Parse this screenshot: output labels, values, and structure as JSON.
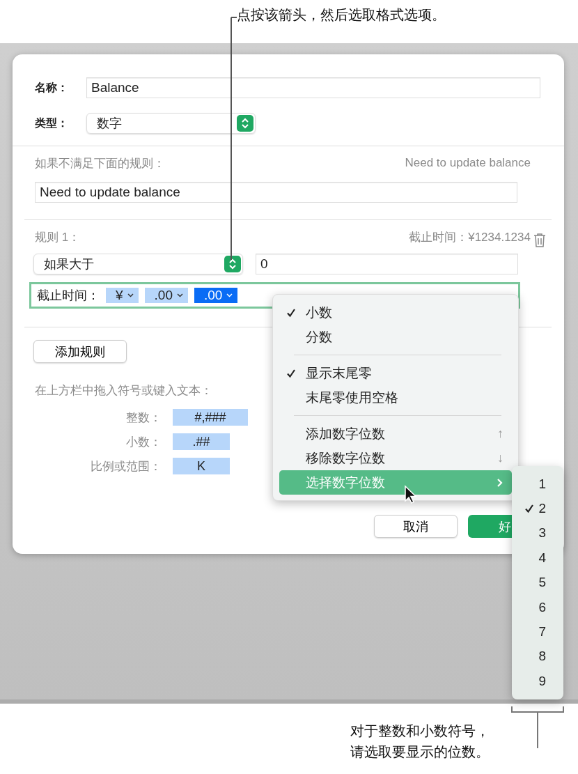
{
  "callout_top": {
    "text": "点按该箭头，然后选取格式选项。"
  },
  "dialog": {
    "name_label": "名称：",
    "name_value": "Balance",
    "type_label": "类型：",
    "type_value": "数字",
    "fallback_label": "如果不满足下面的规则：",
    "fallback_preview": "Need to update balance",
    "fallback_value": "Need to update balance",
    "rule": {
      "title": "规则 1：",
      "preview": "截止时间：¥1234.1234",
      "condition": "如果大于",
      "value": "0",
      "format_label": "截止时间：",
      "tokens": [
        {
          "text": "¥",
          "selected": false
        },
        {
          "text": ".00",
          "selected": false
        },
        {
          "text": ".00",
          "selected": true
        }
      ]
    },
    "add_rule": "添加规则",
    "hint": "在上方栏中拖入符号或键入文本：",
    "symbols": [
      {
        "label": "整数：",
        "token": "#,###"
      },
      {
        "label": "小数：",
        "token": ".##"
      },
      {
        "label": "比例或范围：",
        "token": "K"
      }
    ],
    "buttons": [
      {
        "label": "取消",
        "kind": "secondary"
      },
      {
        "label": "好",
        "kind": "primary"
      }
    ]
  },
  "menu": {
    "items": [
      {
        "kind": "item",
        "label": "小数",
        "checked": true,
        "highlighted": false
      },
      {
        "kind": "item",
        "label": "分数",
        "checked": false,
        "highlighted": false
      },
      {
        "kind": "separator"
      },
      {
        "kind": "item",
        "label": "显示末尾零",
        "checked": true,
        "highlighted": false
      },
      {
        "kind": "item",
        "label": "末尾零使用空格",
        "checked": false,
        "highlighted": false
      },
      {
        "kind": "separator"
      },
      {
        "kind": "item",
        "label": "添加数字位数",
        "shortcut": "↑",
        "checked": false,
        "highlighted": false
      },
      {
        "kind": "item",
        "label": "移除数字位数",
        "shortcut": "↓",
        "checked": false,
        "highlighted": false
      },
      {
        "kind": "submenu",
        "label": "选择数字位数",
        "checked": false,
        "highlighted": true
      }
    ]
  },
  "submenu": {
    "items": [
      {
        "label": "1",
        "checked": false
      },
      {
        "label": "2",
        "checked": true
      },
      {
        "label": "3",
        "checked": false
      },
      {
        "label": "4",
        "checked": false
      },
      {
        "label": "5",
        "checked": false
      },
      {
        "label": "6",
        "checked": false
      },
      {
        "label": "7",
        "checked": false
      },
      {
        "label": "8",
        "checked": false
      },
      {
        "label": "9",
        "checked": false
      }
    ]
  },
  "callout_bottom": {
    "lines": [
      "对于整数和小数符号，",
      "请选取要显示的位数。"
    ]
  }
}
